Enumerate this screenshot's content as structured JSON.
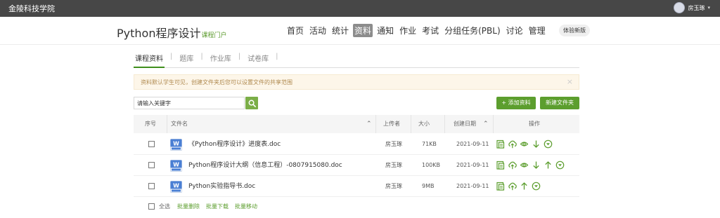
{
  "topbar": {
    "school_name": "金陵科技学院",
    "user_name": "房玉琢"
  },
  "header": {
    "course_title": "Python程序设计",
    "portal_label": "课程门户",
    "nav": [
      "首页",
      "活动",
      "统计",
      "资料",
      "通知",
      "作业",
      "考试",
      "分组任务(PBL)",
      "讨论",
      "管理"
    ],
    "active_nav": "资料",
    "trial_label": "体验新版"
  },
  "subtabs": [
    "课程资料",
    "题库",
    "作业库",
    "试卷库"
  ],
  "active_subtab": "课程资料",
  "notice": "资料默认学生可见，创建文件夹后您可以设置文件的共享范围",
  "search": {
    "value": "请输入关键字"
  },
  "buttons": {
    "add": "+ 添加资料",
    "new_folder": "新建文件夹"
  },
  "table": {
    "headers": {
      "index": "序号",
      "filename": "文件名",
      "uploader": "上传者",
      "size": "大小",
      "date": "创建日期",
      "actions": "操作"
    },
    "rows": [
      {
        "name": "《Python程序设计》进度表.doc",
        "uploader": "房玉琢",
        "size": "71KB",
        "date": "2021-09-11",
        "actions": [
          "download-icon",
          "upload-cloud-icon",
          "preview-eye-icon",
          "move-down-icon",
          "more-circle-icon"
        ]
      },
      {
        "name": "Python程序设计大纲（信息工程）-0807915080.doc",
        "uploader": "房玉琢",
        "size": "100KB",
        "date": "2021-09-11",
        "actions": [
          "download-icon",
          "upload-cloud-icon",
          "preview-eye-icon",
          "move-down-icon",
          "move-up-icon",
          "more-circle-icon"
        ]
      },
      {
        "name": "Python实验指导书.doc",
        "uploader": "房玉琢",
        "size": "9MB",
        "date": "2021-09-11",
        "actions": [
          "download-icon",
          "upload-cloud-icon",
          "move-up-icon",
          "more-circle-icon"
        ]
      }
    ]
  },
  "footer": {
    "select_all": "全选",
    "batch_delete": "批量删除",
    "batch_download": "批量下载",
    "batch_move": "批量移动"
  },
  "colors": {
    "accent_green": "#5c9e2e",
    "topbar": "#474747",
    "notice_bg": "#fdf6e9"
  }
}
